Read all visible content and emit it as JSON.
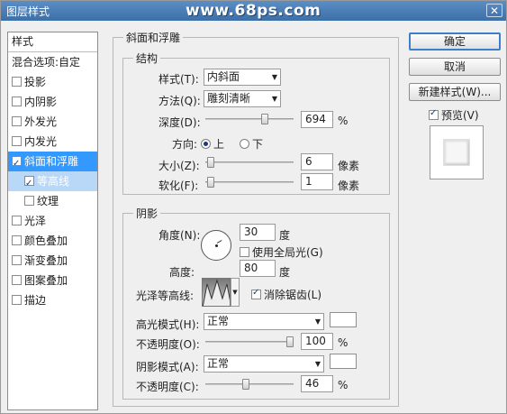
{
  "window": {
    "title": "图层样式",
    "watermark": "www.68ps.com",
    "close_label": "✕"
  },
  "styles": {
    "header": "样式",
    "blend_options": "混合选项:自定",
    "items": [
      {
        "label": "投影",
        "checked": false
      },
      {
        "label": "内阴影",
        "checked": false
      },
      {
        "label": "外发光",
        "checked": false
      },
      {
        "label": "内发光",
        "checked": false
      },
      {
        "label": "斜面和浮雕",
        "checked": true
      },
      {
        "label": "等高线",
        "checked": true
      },
      {
        "label": "纹理",
        "checked": false
      },
      {
        "label": "光泽",
        "checked": false
      },
      {
        "label": "颜色叠加",
        "checked": false
      },
      {
        "label": "渐变叠加",
        "checked": false
      },
      {
        "label": "图案叠加",
        "checked": false
      },
      {
        "label": "描边",
        "checked": false
      }
    ]
  },
  "bevel": {
    "group_title": "斜面和浮雕",
    "structure_title": "结构",
    "style_label": "样式(T):",
    "style_value": "内斜面",
    "technique_label": "方法(Q):",
    "technique_value": "雕刻清晰",
    "depth_label": "深度(D):",
    "depth_value": "694",
    "depth_unit": "%",
    "depth_fraction": 0.69,
    "direction_label": "方向:",
    "direction_up": "上",
    "direction_down": "下",
    "size_label": "大小(Z):",
    "size_value": "6",
    "size_unit": "像素",
    "size_fraction": 0.02,
    "soften_label": "软化(F):",
    "soften_value": "1",
    "soften_unit": "像素",
    "soften_fraction": 0.02
  },
  "shading": {
    "title": "阴影",
    "angle_label": "角度(N):",
    "angle_value": "30",
    "angle_unit": "度",
    "global_light_label": "使用全局光(G)",
    "altitude_label": "高度:",
    "altitude_value": "80",
    "altitude_unit": "度",
    "gloss_label": "光泽等高线:",
    "antialias_label": "消除锯齿(L)",
    "highlight_mode_label": "高光模式(H):",
    "highlight_mode_value": "正常",
    "highlight_opacity_label": "不透明度(O):",
    "highlight_opacity_value": "100",
    "highlight_opacity_unit": "%",
    "highlight_opacity_fraction": 1.0,
    "shadow_mode_label": "阴影模式(A):",
    "shadow_mode_value": "正常",
    "shadow_opacity_label": "不透明度(C):",
    "shadow_opacity_value": "46",
    "shadow_opacity_unit": "%",
    "shadow_opacity_fraction": 0.46,
    "highlight_color": "#ffffff",
    "shadow_color": "#ffffff"
  },
  "buttons": {
    "ok": "确定",
    "cancel": "取消",
    "new_style": "新建样式(W)...",
    "preview_label": "预览(V)"
  },
  "colors": {
    "selected": "#3399ff",
    "title_bar": "#4a7db6"
  }
}
